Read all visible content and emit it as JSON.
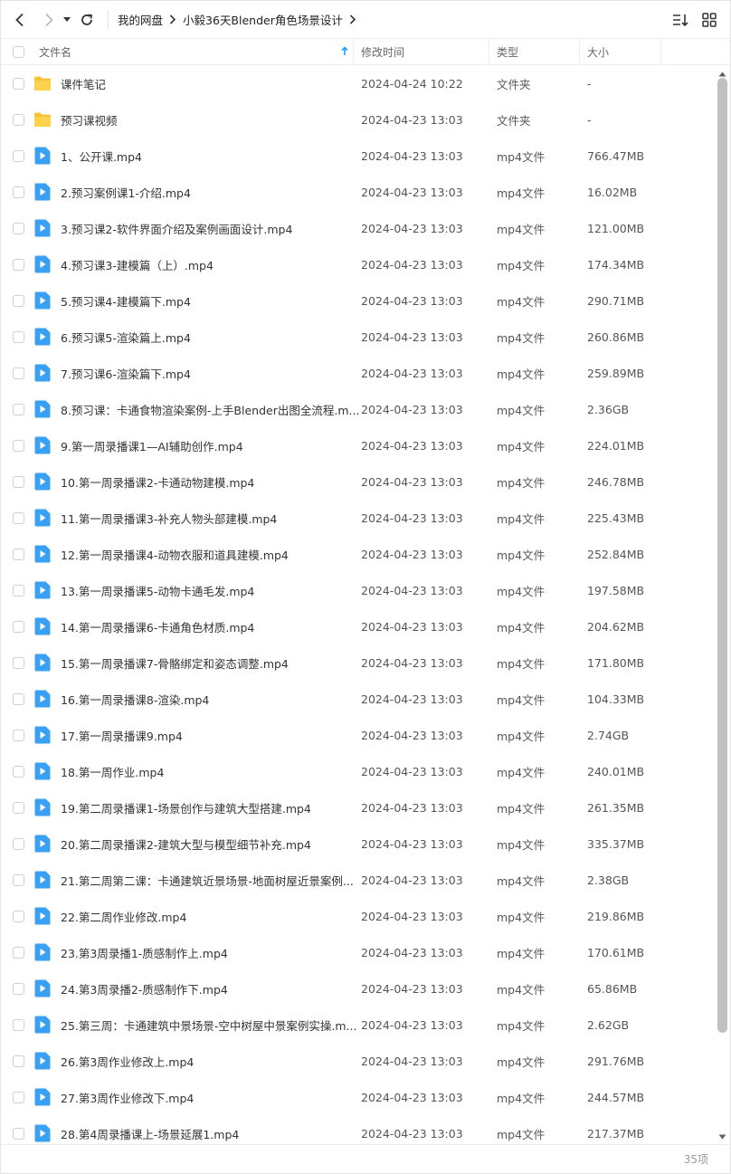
{
  "breadcrumb": [
    "我的网盘",
    "小毅36天Blender角色场景设计"
  ],
  "columns": {
    "name": "文件名",
    "time": "修改时间",
    "type": "类型",
    "size": "大小"
  },
  "colors": {
    "accent": "#1e9fff",
    "folder": "#f8c237",
    "video": "#3aa0f3"
  },
  "files": [
    {
      "icon": "folder-icon",
      "name": "课件笔记",
      "time": "2024-04-24 10:22",
      "type": "文件夹",
      "size": "-"
    },
    {
      "icon": "folder-icon",
      "name": "预习课视频",
      "time": "2024-04-23 13:03",
      "type": "文件夹",
      "size": "-"
    },
    {
      "icon": "video-file-icon",
      "name": "1、公开课.mp4",
      "time": "2024-04-23 13:03",
      "type": "mp4文件",
      "size": "766.47MB"
    },
    {
      "icon": "video-file-icon",
      "name": "2.预习案例课1-介绍.mp4",
      "time": "2024-04-23 13:03",
      "type": "mp4文件",
      "size": "16.02MB"
    },
    {
      "icon": "video-file-icon",
      "name": "3.预习课2-软件界面介绍及案例画面设计.mp4",
      "time": "2024-04-23 13:03",
      "type": "mp4文件",
      "size": "121.00MB"
    },
    {
      "icon": "video-file-icon",
      "name": "4.预习课3-建模篇（上）.mp4",
      "time": "2024-04-23 13:03",
      "type": "mp4文件",
      "size": "174.34MB"
    },
    {
      "icon": "video-file-icon",
      "name": "5.预习课4-建模篇下.mp4",
      "time": "2024-04-23 13:03",
      "type": "mp4文件",
      "size": "290.71MB"
    },
    {
      "icon": "video-file-icon",
      "name": "6.预习课5-渲染篇上.mp4",
      "time": "2024-04-23 13:03",
      "type": "mp4文件",
      "size": "260.86MB"
    },
    {
      "icon": "video-file-icon",
      "name": "7.预习课6-渲染篇下.mp4",
      "time": "2024-04-23 13:03",
      "type": "mp4文件",
      "size": "259.89MB"
    },
    {
      "icon": "video-file-icon",
      "name": "8.预习课：卡通食物渲染案例-上手Blender出图全流程.m...",
      "time": "2024-04-23 13:03",
      "type": "mp4文件",
      "size": "2.36GB"
    },
    {
      "icon": "video-file-icon",
      "name": "9.第一周录播课1—AI辅助创作.mp4",
      "time": "2024-04-23 13:03",
      "type": "mp4文件",
      "size": "224.01MB"
    },
    {
      "icon": "video-file-icon",
      "name": "10.第一周录播课2-卡通动物建模.mp4",
      "time": "2024-04-23 13:03",
      "type": "mp4文件",
      "size": "246.78MB"
    },
    {
      "icon": "video-file-icon",
      "name": "11.第一周录播课3-补充人物头部建模.mp4",
      "time": "2024-04-23 13:03",
      "type": "mp4文件",
      "size": "225.43MB"
    },
    {
      "icon": "video-file-icon",
      "name": "12.第一周录播课4-动物衣服和道具建模.mp4",
      "time": "2024-04-23 13:03",
      "type": "mp4文件",
      "size": "252.84MB"
    },
    {
      "icon": "video-file-icon",
      "name": "13.第一周录播课5-动物卡通毛发.mp4",
      "time": "2024-04-23 13:03",
      "type": "mp4文件",
      "size": "197.58MB"
    },
    {
      "icon": "video-file-icon",
      "name": "14.第一周录播课6-卡通角色材质.mp4",
      "time": "2024-04-23 13:03",
      "type": "mp4文件",
      "size": "204.62MB"
    },
    {
      "icon": "video-file-icon",
      "name": "15.第一周录播课7-骨骼绑定和姿态调整.mp4",
      "time": "2024-04-23 13:03",
      "type": "mp4文件",
      "size": "171.80MB"
    },
    {
      "icon": "video-file-icon",
      "name": "16.第一周录播课8-渲染.mp4",
      "time": "2024-04-23 13:03",
      "type": "mp4文件",
      "size": "104.33MB"
    },
    {
      "icon": "video-file-icon",
      "name": "17.第一周录播课9.mp4",
      "time": "2024-04-23 13:03",
      "type": "mp4文件",
      "size": "2.74GB"
    },
    {
      "icon": "video-file-icon",
      "name": "18.第一周作业.mp4",
      "time": "2024-04-23 13:03",
      "type": "mp4文件",
      "size": "240.01MB"
    },
    {
      "icon": "video-file-icon",
      "name": "19.第二周录播课1-场景创作与建筑大型搭建.mp4",
      "time": "2024-04-23 13:03",
      "type": "mp4文件",
      "size": "261.35MB"
    },
    {
      "icon": "video-file-icon",
      "name": "20.第二周录播课2-建筑大型与模型细节补充.mp4",
      "time": "2024-04-23 13:03",
      "type": "mp4文件",
      "size": "335.37MB"
    },
    {
      "icon": "video-file-icon",
      "name": "21.第二周第二课：卡通建筑近景场景-地面树屋近景案例...",
      "time": "2024-04-23 13:03",
      "type": "mp4文件",
      "size": "2.38GB"
    },
    {
      "icon": "video-file-icon",
      "name": "22.第二周作业修改.mp4",
      "time": "2024-04-23 13:03",
      "type": "mp4文件",
      "size": "219.86MB"
    },
    {
      "icon": "video-file-icon",
      "name": "23.第3周录播1-质感制作上.mp4",
      "time": "2024-04-23 13:03",
      "type": "mp4文件",
      "size": "170.61MB"
    },
    {
      "icon": "video-file-icon",
      "name": "24.第3周录播2-质感制作下.mp4",
      "time": "2024-04-23 13:03",
      "type": "mp4文件",
      "size": "65.86MB"
    },
    {
      "icon": "video-file-icon",
      "name": "25.第三周：卡通建筑中景场景-空中树屋中景案例实操.m...",
      "time": "2024-04-23 13:03",
      "type": "mp4文件",
      "size": "2.62GB"
    },
    {
      "icon": "video-file-icon",
      "name": "26.第3周作业修改上.mp4",
      "time": "2024-04-23 13:03",
      "type": "mp4文件",
      "size": "291.76MB"
    },
    {
      "icon": "video-file-icon",
      "name": "27.第3周作业修改下.mp4",
      "time": "2024-04-23 13:03",
      "type": "mp4文件",
      "size": "244.57MB"
    },
    {
      "icon": "video-file-icon",
      "name": "28.第4周录播课上-场景延展1.mp4",
      "time": "2024-04-23 13:03",
      "type": "mp4文件",
      "size": "217.37MB"
    }
  ],
  "status": {
    "count": "35项"
  }
}
